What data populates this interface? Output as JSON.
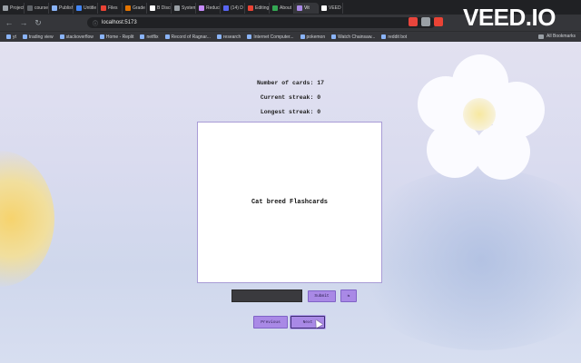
{
  "browser": {
    "tabs": [
      {
        "label": "Project",
        "color": "#9aa0a6"
      },
      {
        "label": "course",
        "color": "#5f6368"
      },
      {
        "label": "Publish",
        "color": "#8ab4f8"
      },
      {
        "label": "Untitle",
        "color": "#4285f4"
      },
      {
        "label": "Files",
        "color": "#ea4335"
      },
      {
        "label": "Grade",
        "color": "#e37400"
      },
      {
        "label": "B Discu",
        "color": "#ffffff"
      },
      {
        "label": "System",
        "color": "#9aa0a6"
      },
      {
        "label": "Reduci",
        "color": "#c58af9"
      },
      {
        "label": "(14) D",
        "color": "#5865f2"
      },
      {
        "label": "Editing",
        "color": "#ea4335"
      },
      {
        "label": "About",
        "color": "#34a853"
      },
      {
        "label": "Vit",
        "color": "#a989e6"
      },
      {
        "label": "VEED",
        "color": "#ffffff"
      }
    ],
    "address": {
      "url": "localhost:5173"
    },
    "bookmarks": [
      "yt",
      "trading view",
      "stackoverflow",
      "Home - Replit",
      "netflix",
      "Record of Ragnar...",
      "research",
      "Internet Computer...",
      "pokemon",
      "Watch Chainsaw...",
      "reddit bot"
    ],
    "all_bookmarks": "All Bookmarks"
  },
  "watermark": "VEED.IO",
  "page": {
    "stats": {
      "cards": "Number of cards: 17",
      "current_streak": "Current streak: 0",
      "longest_streak": "Longest streak: 0"
    },
    "card_text": "Cat breed Flashcards",
    "answer_placeholder": "",
    "submit_label": "Submit",
    "small_button_label": "⇆",
    "prev_label": "Previous",
    "next_label": "Next"
  },
  "colors": {
    "accent": "#a989e6",
    "card_border": "#a89bd6",
    "chrome_bg": "#35363a"
  }
}
